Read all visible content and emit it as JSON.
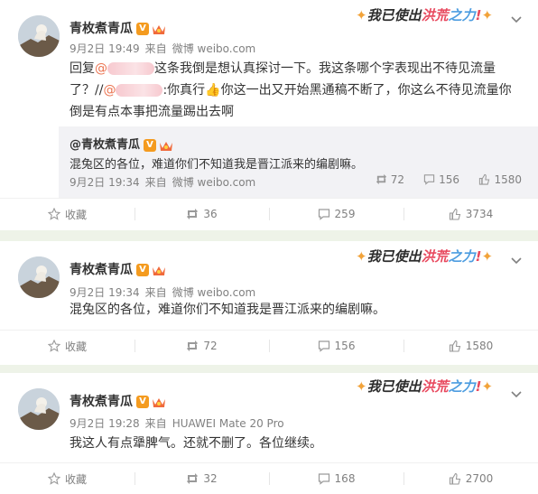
{
  "user": {
    "name": "青枚煮青瓜",
    "vip_letter": "V"
  },
  "badge": {
    "left_sparkle": "✦",
    "part1": "我已使出",
    "part2": "洪荒",
    "part3": "之力",
    "bang": "!",
    "right_sparkle": "✦"
  },
  "posts": [
    {
      "meta": {
        "date": "9月2日 19:49",
        "from": "来自",
        "source": "微博 weibo.com"
      },
      "text": {
        "l1a": "回复",
        "l1m": "@",
        "l1b": "这条我倒是想认真探讨一下。我这条哪个字表现出不待见流量",
        "l2a": "了？//",
        "l2m": "@",
        "l2b": ":你真行",
        "l2emoji": "👍",
        "l2c": "你这一出又开始黑通稿不断了，你这么不待见流量你",
        "l3": "倒是有点本事把流量踢出去啊"
      },
      "repost": {
        "name": "@青枚煮青瓜",
        "text": "混兔区的各位，难道你们不知道我是晋江派来的编剧嘛。",
        "meta": {
          "date": "9月2日 19:34",
          "from": "来自",
          "source": "微博 weibo.com"
        },
        "reposts": "72",
        "comments": "156",
        "likes": "1580"
      },
      "actions": {
        "fav": "收藏",
        "reposts": "36",
        "comments": "259",
        "likes": "3734"
      }
    },
    {
      "meta": {
        "date": "9月2日 19:34",
        "from": "来自",
        "source": "微博 weibo.com"
      },
      "text": "混兔区的各位，难道你们不知道我是晋江派来的编剧嘛。",
      "actions": {
        "fav": "收藏",
        "reposts": "72",
        "comments": "156",
        "likes": "1580"
      }
    },
    {
      "meta": {
        "date": "9月2日 19:28",
        "from": "来自",
        "source": "HUAWEI Mate 20 Pro"
      },
      "text": "我这人有点犟脾气。还就不删了。各位继续。",
      "actions": {
        "fav": "收藏",
        "reposts": "32",
        "comments": "168",
        "likes": "2700"
      }
    }
  ],
  "icons": [
    "star-icon",
    "repost-icon",
    "comment-icon",
    "like-icon",
    "chevron-down-icon",
    "crown-icon",
    "avatar"
  ]
}
